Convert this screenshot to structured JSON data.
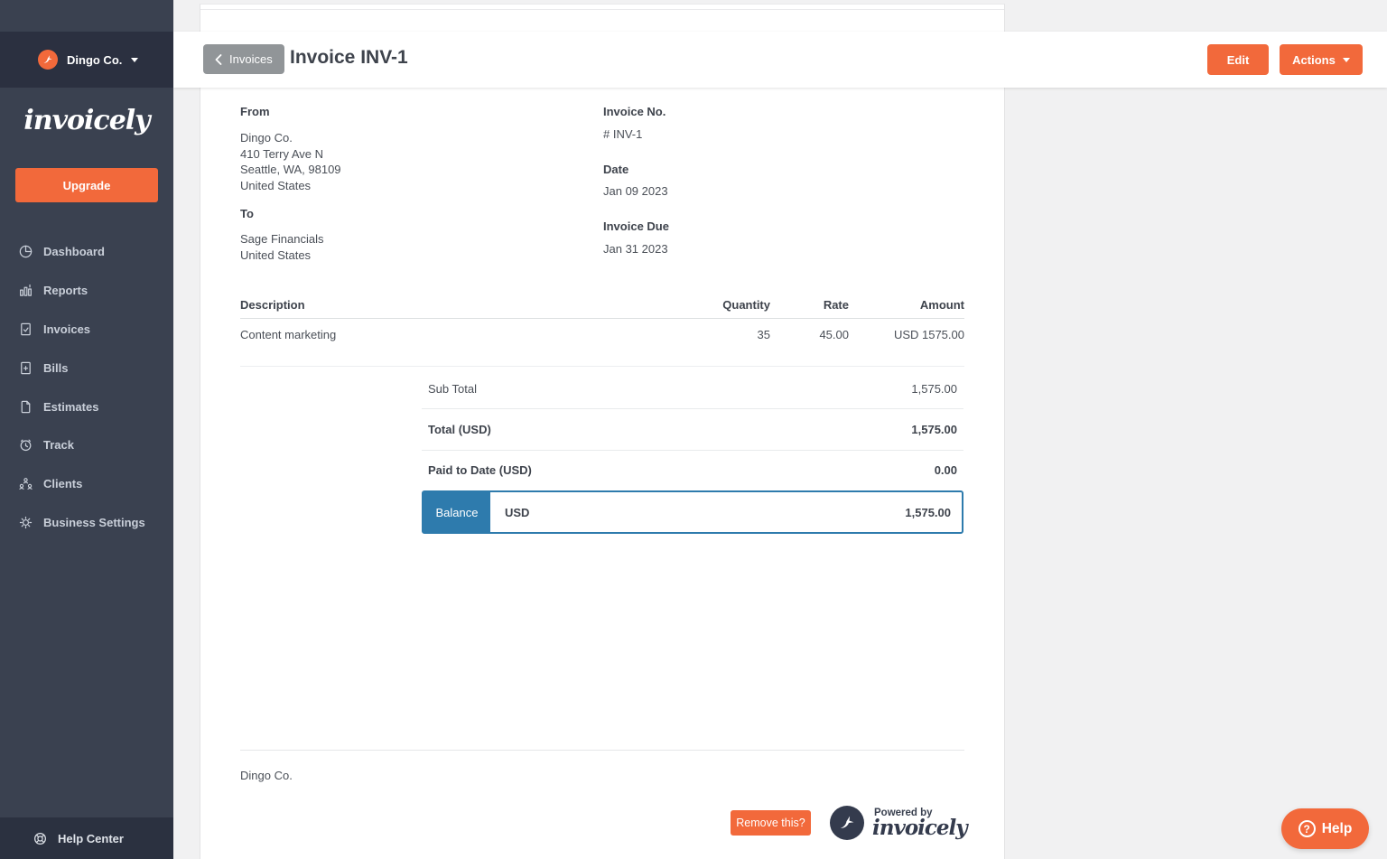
{
  "colors": {
    "accent_orange": "#f2693b",
    "sidebar_bg": "#3a4150",
    "sidebar_dark_bg": "#2b3040",
    "balance_blue": "#2e7bad",
    "page_bg": "#f1f1f2"
  },
  "sidebar": {
    "account_name": "Dingo Co.",
    "brand_logo_text": "invoicely",
    "upgrade_label": "Upgrade",
    "items": [
      {
        "icon": "pie-chart-icon",
        "label": "Dashboard"
      },
      {
        "icon": "bar-chart-icon",
        "label": "Reports"
      },
      {
        "icon": "document-check-icon",
        "label": "Invoices"
      },
      {
        "icon": "document-plus-icon",
        "label": "Bills"
      },
      {
        "icon": "document-icon",
        "label": "Estimates"
      },
      {
        "icon": "clock-icon",
        "label": "Track"
      },
      {
        "icon": "people-icon",
        "label": "Clients"
      },
      {
        "icon": "gear-icon",
        "label": "Business Settings"
      }
    ],
    "help_center_label": "Help Center"
  },
  "header": {
    "back_label": "Invoices",
    "title": "Invoice INV-1",
    "edit_label": "Edit",
    "actions_label": "Actions"
  },
  "invoice": {
    "from_label": "From",
    "from_lines": [
      "Dingo Co.",
      "410 Terry Ave N",
      "Seattle, WA, 98109",
      "United States"
    ],
    "to_label": "To",
    "to_lines": [
      "Sage Financials",
      "United States"
    ],
    "invoice_no_label": "Invoice No.",
    "invoice_no": "# INV-1",
    "date_label": "Date",
    "date": "Jan 09 2023",
    "due_label": "Invoice Due",
    "due": "Jan 31 2023",
    "table": {
      "headers": [
        "Description",
        "Quantity",
        "Rate",
        "Amount"
      ],
      "rows": [
        [
          "Content marketing",
          "35",
          "45.00",
          "USD 1575.00"
        ]
      ]
    },
    "totals": [
      {
        "label": "Sub Total",
        "value": "1,575.00"
      },
      {
        "label": "Total (USD)",
        "value": "1,575.00"
      },
      {
        "label": "Paid to Date (USD)",
        "value": "0.00"
      }
    ],
    "balance": {
      "label": "Balance",
      "currency": "USD",
      "value": "1,575.00"
    },
    "footer_company": "Dingo Co.",
    "remove_label": "Remove this?"
  },
  "footer_branding": {
    "powered_by": "Powered by",
    "brand": "invoicely"
  },
  "help_widget": {
    "label": "Help",
    "icon_glyph": "?"
  }
}
